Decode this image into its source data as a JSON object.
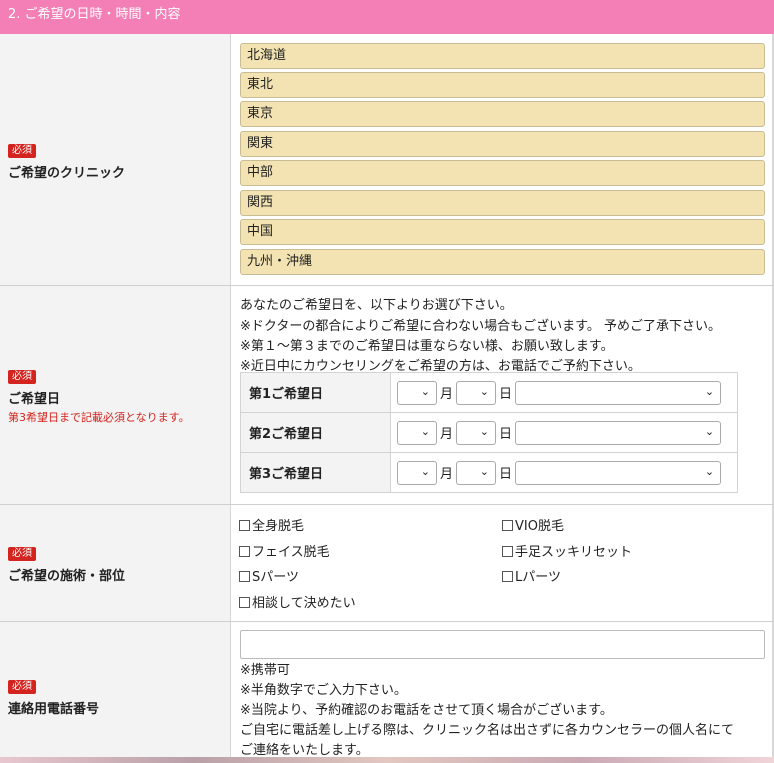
{
  "section": {
    "title": "2. ご希望の日時・時間・内容"
  },
  "required_badge": "必須",
  "clinic": {
    "label": "ご希望のクリニック",
    "regions": [
      "北海道",
      "東北",
      "東京",
      "関東",
      "中部",
      "関西",
      "中国",
      "九州・沖縄"
    ]
  },
  "dates": {
    "label": "ご希望日",
    "note": "第3希望日まで記載必須となります。",
    "intro": [
      "あなたのご希望日を、以下よりお選び下さい。",
      "※ドクターの都合によりご希望に合わない場合もございます。 予めご了承下さい。",
      "※第１～第３までのご希望日は重ならない様、お願い致します。",
      "※近日中にカウンセリングをご希望の方は、お電話でご予約下さい。"
    ],
    "rows": [
      {
        "label": "第1ご希望日",
        "month_unit": "月",
        "day_unit": "日"
      },
      {
        "label": "第2ご希望日",
        "month_unit": "月",
        "day_unit": "日"
      },
      {
        "label": "第3ご希望日",
        "month_unit": "月",
        "day_unit": "日"
      }
    ]
  },
  "treatments": {
    "label": "ご希望の施術・部位",
    "options": [
      "全身脱毛",
      "VIO脱毛",
      "フェイス脱毛",
      "手足スッキリセット",
      "Sパーツ",
      "Lパーツ",
      "相談して決めたい"
    ]
  },
  "phone": {
    "label": "連絡用電話番号",
    "value": "",
    "notes": [
      "※携帯可",
      "※半角数字でご入力下さい。",
      "※当院より、予約確認のお電話をさせて頂く場合がございます。",
      "ご自宅に電話差し上げる際は、クリニック名は出さずに各カウンセラーの個人名にて",
      "ご連絡をいたします。"
    ]
  },
  "icons": {
    "select_arrow": "chevron-down-icon",
    "checkbox": "checkbox-icon"
  }
}
